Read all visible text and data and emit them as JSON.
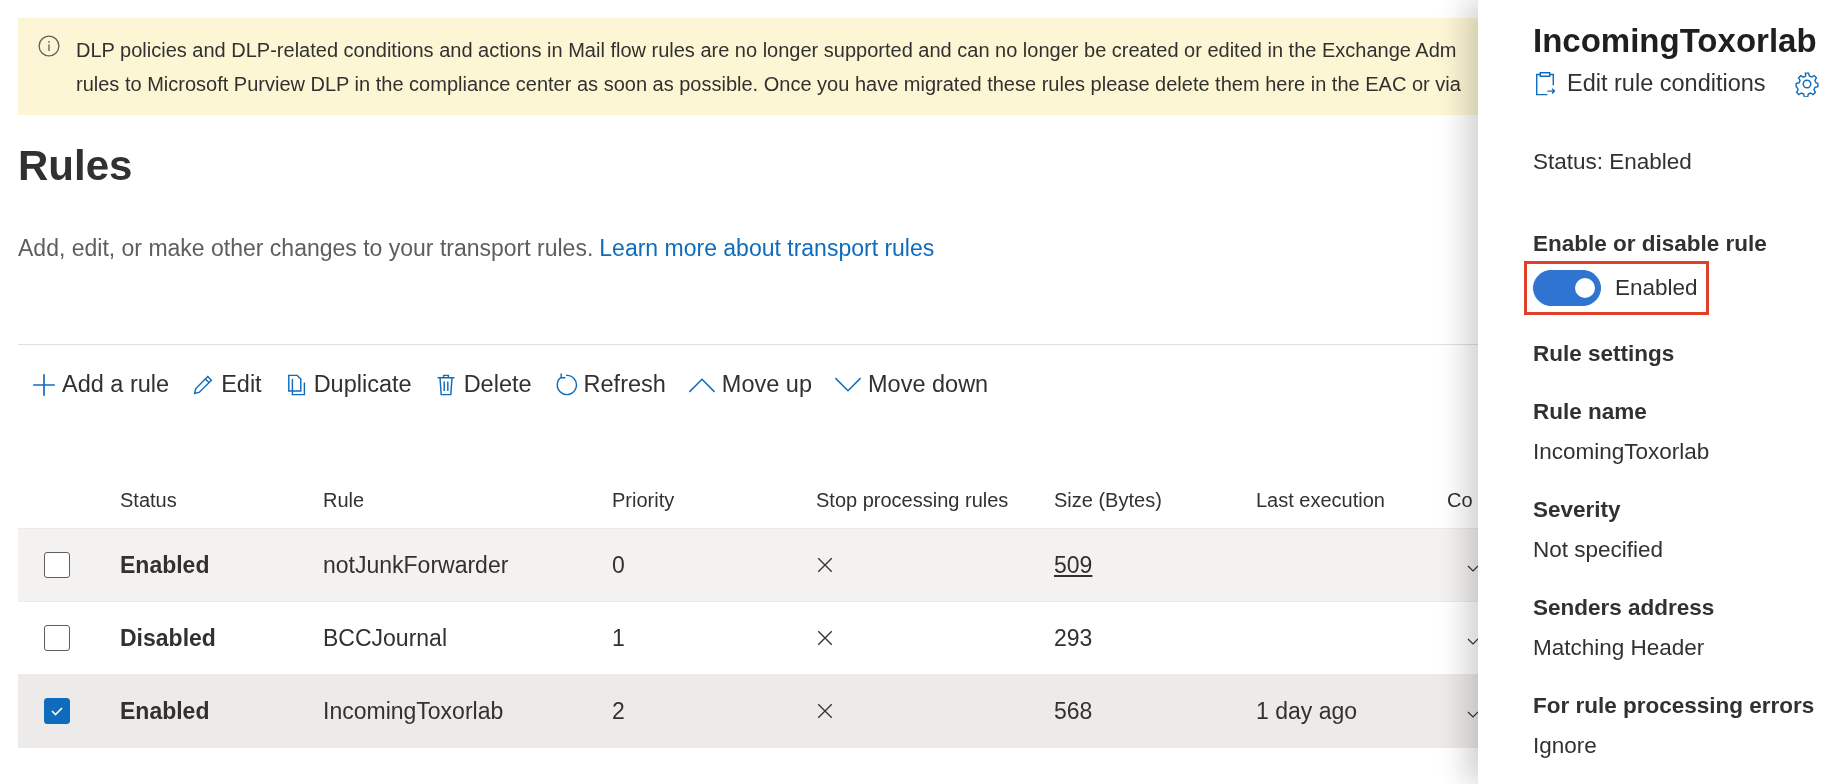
{
  "banner": {
    "lines": [
      "DLP policies and DLP-related conditions and actions in Mail flow rules are no longer supported and can no longer be created or edited in the Exchange Adm",
      "rules to Microsoft Purview DLP in the compliance center as soon as possible. Once you have migrated these rules please delete them here in the EAC or via"
    ]
  },
  "page": {
    "title": "Rules",
    "description": "Add, edit, or make other changes to your transport rules.",
    "link": "Learn more about transport rules"
  },
  "toolbar": [
    {
      "kind": "add",
      "label": "Add a rule"
    },
    {
      "kind": "edit",
      "label": "Edit"
    },
    {
      "kind": "duplicate",
      "label": "Duplicate"
    },
    {
      "kind": "delete",
      "label": "Delete"
    },
    {
      "kind": "refresh",
      "label": "Refresh"
    },
    {
      "kind": "up",
      "label": "Move up"
    },
    {
      "kind": "down",
      "label": "Move down"
    }
  ],
  "table": {
    "columns": [
      "Status",
      "Rule",
      "Priority",
      "Stop processing rules",
      "Size (Bytes)",
      "Last execution",
      "Co"
    ],
    "rows": [
      {
        "selected": false,
        "hovered": true,
        "status": "Enabled",
        "rule": "notJunkForwarder",
        "priority": "0",
        "stop_processing": false,
        "size": "509",
        "size_underlined": true,
        "last_execution": ""
      },
      {
        "selected": false,
        "hovered": false,
        "status": "Disabled",
        "rule": "BCCJournal",
        "priority": "1",
        "stop_processing": false,
        "size": "293",
        "size_underlined": false,
        "last_execution": ""
      },
      {
        "selected": true,
        "hovered": false,
        "status": "Enabled",
        "rule": "IncomingToxorlab",
        "priority": "2",
        "stop_processing": false,
        "size": "568",
        "size_underlined": false,
        "last_execution": "1 day ago"
      }
    ]
  },
  "panel": {
    "title": "IncomingToxorlab",
    "edit_button": "Edit rule conditions",
    "status": "Status: Enabled",
    "toggle": {
      "label": "Enable or disable rule",
      "on": true,
      "text": "Enabled"
    },
    "section": "Rule settings",
    "fields": [
      {
        "label": "Rule name",
        "value": "IncomingToxorlab"
      },
      {
        "label": "Severity",
        "value": "Not specified"
      },
      {
        "label": "Senders address",
        "value": "Matching Header"
      },
      {
        "label": "For rule processing errors",
        "value": "Ignore"
      }
    ]
  }
}
